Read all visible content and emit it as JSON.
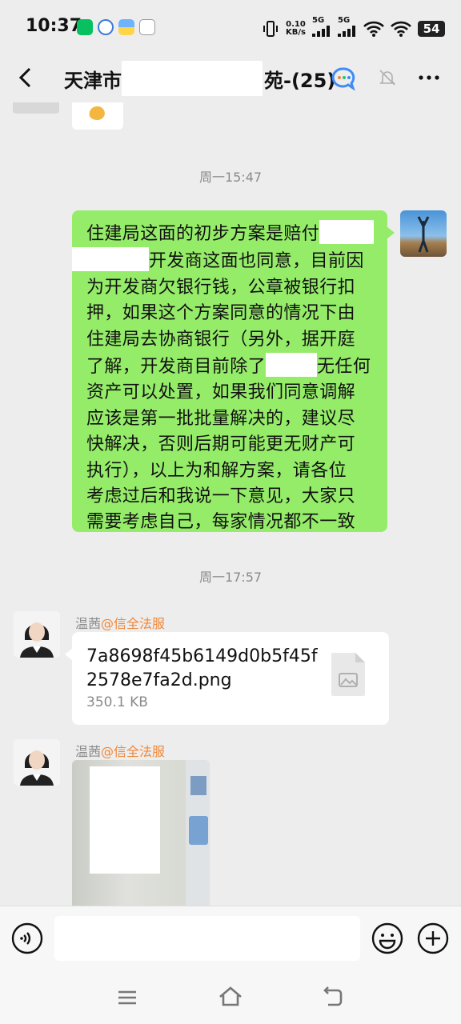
{
  "status_bar": {
    "time": "10:37",
    "net_speed_value": "0.10",
    "net_speed_unit": "KB/s",
    "signal_1_label": "5G",
    "signal_2_label": "5G",
    "battery": "54"
  },
  "header": {
    "title_left": "天津市",
    "title_right": "苑-(25)"
  },
  "chat": {
    "timestamp_1": "周一15:47",
    "sent_message_lines": {
      "l1": "住建局这面的初步方案是赔付",
      "l2": "开发商这面也同意，目前因",
      "l3": "为开发商欠银行钱，公章被银行扣",
      "l4": "押，如果这个方案同意的情况下由",
      "l5": "住建局去协商银行（另外，据开庭",
      "l6a": "了解，开发商目前除了",
      "l6b": "无任何",
      "l7": "资产可以处置，如果我们同意调解",
      "l8": "应该是第一批批量解决的，建议尽",
      "l9": "快解决，否则后期可能更无财产可",
      "l10": "执行），以上为和解方案，请各位",
      "l11": "考虑过后和我说一下意见，大家只",
      "l12": "需要考虑自己，每家情况都不一致"
    },
    "timestamp_2": "周一17:57",
    "sender_1": {
      "name": "温茜",
      "org": "@信全法服"
    },
    "file": {
      "name": "7a8698f45b6149d0b5f45f2578e7fa2d.png",
      "size": "350.1 KB"
    },
    "sender_2": {
      "name": "温茜",
      "org": "@信全法服"
    }
  },
  "colors": {
    "sent_bubble": "#95ec69",
    "background": "#ededed",
    "org_label": "#f0883a"
  }
}
